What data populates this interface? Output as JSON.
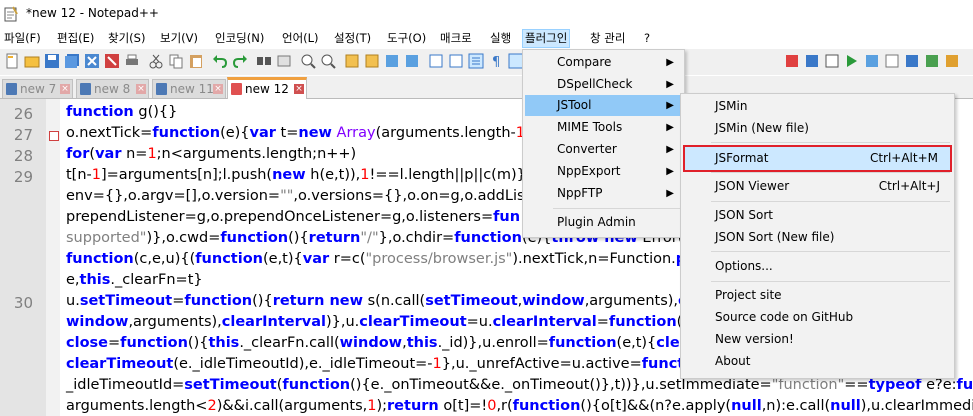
{
  "window": {
    "title": "*new 12 - Notepad++"
  },
  "menubar": {
    "items": [
      "파일(F)",
      "편집(E)",
      "찾기(S)",
      "보기(V)",
      "인코딩(N)",
      "언어(L)",
      "설정(T)",
      "도구(O)",
      "매크로",
      "실행",
      "플러그인",
      "창 관리",
      "?"
    ],
    "active": "플러그인"
  },
  "tabs": [
    {
      "label": "new 7",
      "active": false
    },
    {
      "label": "new 8",
      "active": false
    },
    {
      "label": "new 11",
      "active": false
    },
    {
      "label": "new 12",
      "active": true
    }
  ],
  "editor": {
    "line_numbers": [
      "26",
      "27",
      "28",
      "29",
      "30"
    ]
  },
  "plugins_menu": {
    "items": [
      "Compare",
      "DSpellCheck",
      "JSTool",
      "MIME Tools",
      "Converter",
      "NppExport",
      "NppFTP",
      "Plugin Admin"
    ],
    "hovered": "JSTool"
  },
  "jstool_menu": {
    "items": [
      {
        "label": "JSMin",
        "shortcut": ""
      },
      {
        "label": "JSMin (New file)",
        "shortcut": ""
      },
      {
        "label": "JSFormat",
        "shortcut": "Ctrl+Alt+M"
      },
      {
        "label": "JSON Viewer",
        "shortcut": "Ctrl+Alt+J"
      },
      {
        "label": "JSON Sort",
        "shortcut": ""
      },
      {
        "label": "JSON Sort (New file)",
        "shortcut": ""
      },
      {
        "label": "Options...",
        "shortcut": ""
      },
      {
        "label": "Project site",
        "shortcut": ""
      },
      {
        "label": "Source code on GitHub",
        "shortcut": ""
      },
      {
        "label": "New version!",
        "shortcut": ""
      },
      {
        "label": "About",
        "shortcut": ""
      }
    ],
    "selected": "JSFormat"
  },
  "colors": {
    "highlight_border": "#e0202a",
    "submenu_hover": "#91c9f7",
    "keyword": "#0000ff",
    "string": "#808080",
    "number": "#ff0000"
  }
}
